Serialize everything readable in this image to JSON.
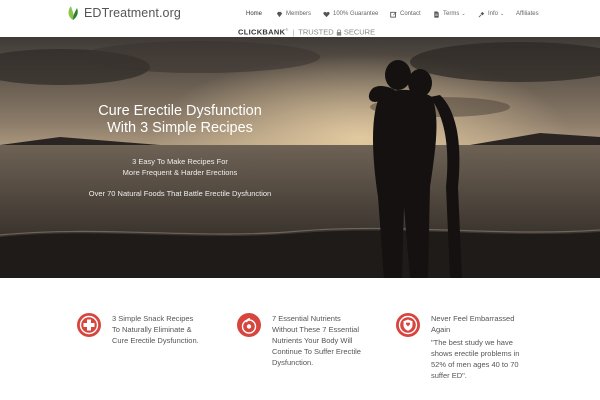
{
  "site": {
    "name": "EDTreatment.org",
    "logo_icon": "leaf-icon",
    "brand_color": "#d6453e"
  },
  "nav": {
    "items": [
      {
        "label": "Home",
        "icon": "",
        "has_dropdown": false
      },
      {
        "label": "Members",
        "icon": "gem-icon",
        "has_dropdown": false
      },
      {
        "label": "100% Guarantee",
        "icon": "heart-icon",
        "has_dropdown": false
      },
      {
        "label": "Contact",
        "icon": "edit-icon",
        "has_dropdown": false
      },
      {
        "label": "Terms",
        "icon": "document-icon",
        "has_dropdown": true
      },
      {
        "label": "Info",
        "icon": "pin-icon",
        "has_dropdown": true
      },
      {
        "label": "Affiliates",
        "icon": "",
        "has_dropdown": false
      }
    ]
  },
  "clickbank": {
    "brand": "CLICKBANK",
    "reg": "®",
    "sep": "|",
    "trusted": "TRUSTED",
    "secure": "SECURE"
  },
  "hero": {
    "title_line1": "Cure Erectile Dysfunction",
    "title_line2": "With 3 Simple Recipes",
    "sub_line1": "3 Easy To Make Recipes For",
    "sub_line2": "More Frequent & Harder Erections",
    "line3": "Over 70 Natural Foods That Battle Erectile Dysfunction"
  },
  "features": [
    {
      "icon": "medical-cross-icon",
      "lines": [
        "3 Simple Snack Recipes",
        "To Naturally Eliminate &",
        "Cure Erectile Dysfunction."
      ]
    },
    {
      "icon": "nutrients-icon",
      "lines": [
        "7 Essential Nutrients",
        "Without These 7 Essential",
        "Nutrients Your Body Will",
        "Continue To Suffer Erectile",
        "Dysfunction."
      ]
    },
    {
      "icon": "shield-icon",
      "lines": [
        "Never Feel Embarrassed",
        "Again"
      ],
      "quote": [
        "\"The best study we have",
        "shows erectile problems in",
        "52% of men ages 40 to 70",
        "suffer ED\"."
      ]
    }
  ]
}
